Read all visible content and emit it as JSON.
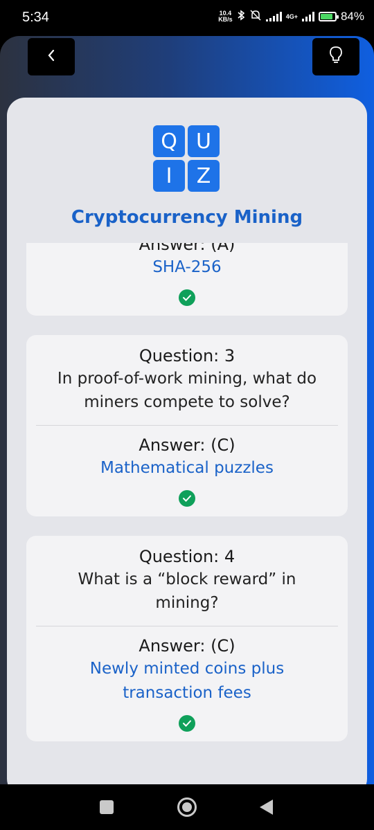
{
  "status_bar": {
    "time": "5:34",
    "net_speed_value": "10.4",
    "net_speed_unit": "KB/s",
    "network_type": "4G+",
    "battery_percent": "84%",
    "battery_level": 0.84
  },
  "header": {
    "back_icon": "chevron-left-icon",
    "hint_icon": "lightbulb-icon"
  },
  "logo": {
    "letters": [
      "Q",
      "U",
      "I",
      "Z"
    ],
    "color": "#1e73e8"
  },
  "quiz": {
    "title": "Cryptocurrency Mining"
  },
  "items": [
    {
      "answer_label": "Answer: (A)",
      "answer_value": "SHA-256",
      "correct": true
    },
    {
      "question_label": "Question: 3",
      "question_text": "In proof-of-work mining, what do miners compete to solve?",
      "answer_label": "Answer: (C)",
      "answer_value": "Mathematical puzzles",
      "correct": true
    },
    {
      "question_label": "Question: 4",
      "question_text": "What is a “block reward” in mining?",
      "answer_label": "Answer: (C)",
      "answer_value": "Newly minted coins plus transaction fees",
      "correct": true
    }
  ],
  "colors": {
    "accent": "#1a62c8",
    "correct": "#0fa05a",
    "card_bg": "#e4e5ea"
  }
}
